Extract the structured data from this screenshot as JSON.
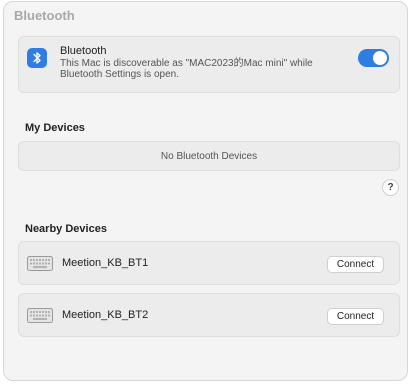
{
  "pane": {
    "title": "Bluetooth"
  },
  "bluetooth": {
    "title": "Bluetooth",
    "description": "This Mac is discoverable as \"MAC2023的Mac mini\" while Bluetooth Settings is open.",
    "enabled": true,
    "icon": "bluetooth-icon",
    "accent_color": "#2f7de1"
  },
  "my_devices": {
    "title": "My Devices",
    "empty_text": "No Bluetooth Devices"
  },
  "help": {
    "label": "?"
  },
  "nearby": {
    "title": "Nearby Devices",
    "devices": [
      {
        "name": "Meetion_KB_BT1",
        "icon": "keyboard-icon",
        "action": "Connect"
      },
      {
        "name": "Meetion_KB_BT2",
        "icon": "keyboard-icon",
        "action": "Connect"
      }
    ]
  }
}
